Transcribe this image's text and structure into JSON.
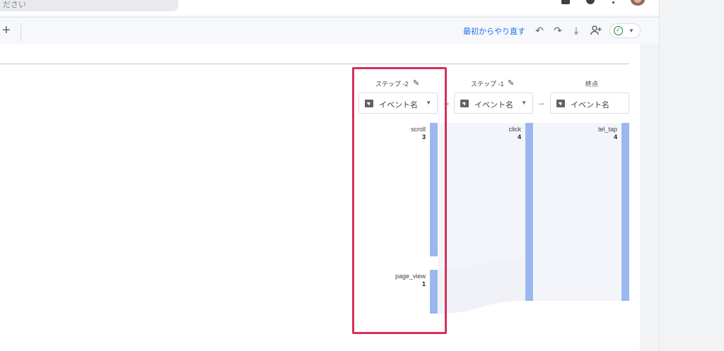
{
  "search": {
    "placeholder_fragment": "ださい"
  },
  "toolbar": {
    "add_tab": "+",
    "reset_label": "最初からやり直す"
  },
  "funnel": {
    "steps": [
      {
        "header": "ステップ -2",
        "dimension": "イベント名",
        "nodes": [
          {
            "label": "scroll",
            "count": "3"
          },
          {
            "label": "page_view",
            "count": "1"
          }
        ]
      },
      {
        "header": "ステップ -1",
        "dimension": "イベント名",
        "nodes": [
          {
            "label": "click",
            "count": "4"
          }
        ]
      },
      {
        "header": "終点",
        "dimension": "イベント名",
        "nodes": [
          {
            "label": "tel_tap",
            "count": "4"
          }
        ]
      }
    ]
  },
  "colors": {
    "bar": "#9ab8ef",
    "highlight": "#d6305b",
    "link": "#1a73e8"
  }
}
